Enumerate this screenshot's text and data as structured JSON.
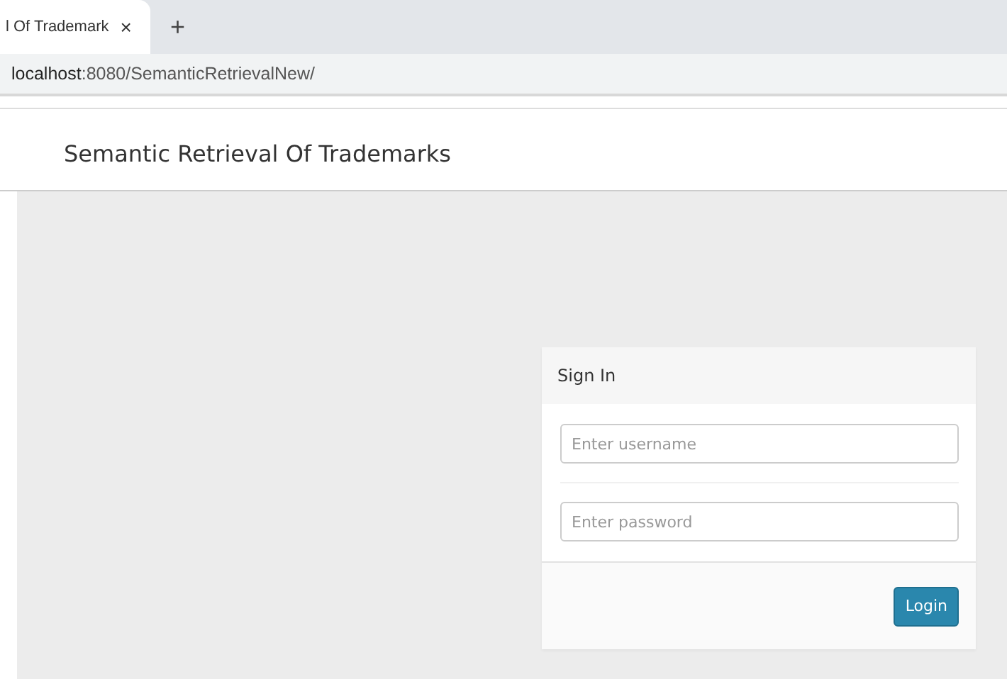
{
  "browser": {
    "tab": {
      "title": "l Of Trademark",
      "close": "×",
      "selected": true
    },
    "new_tab": "+",
    "address": {
      "host": "localhost",
      "path": ":8080/SemanticRetrievalNew/"
    }
  },
  "header": {
    "title": "Semantic Retrieval Of Trademarks"
  },
  "login": {
    "title": "Sign In",
    "fields": [
      {
        "placeholder": "Enter username"
      },
      {
        "placeholder": "Enter password"
      }
    ],
    "button": "Login"
  }
}
